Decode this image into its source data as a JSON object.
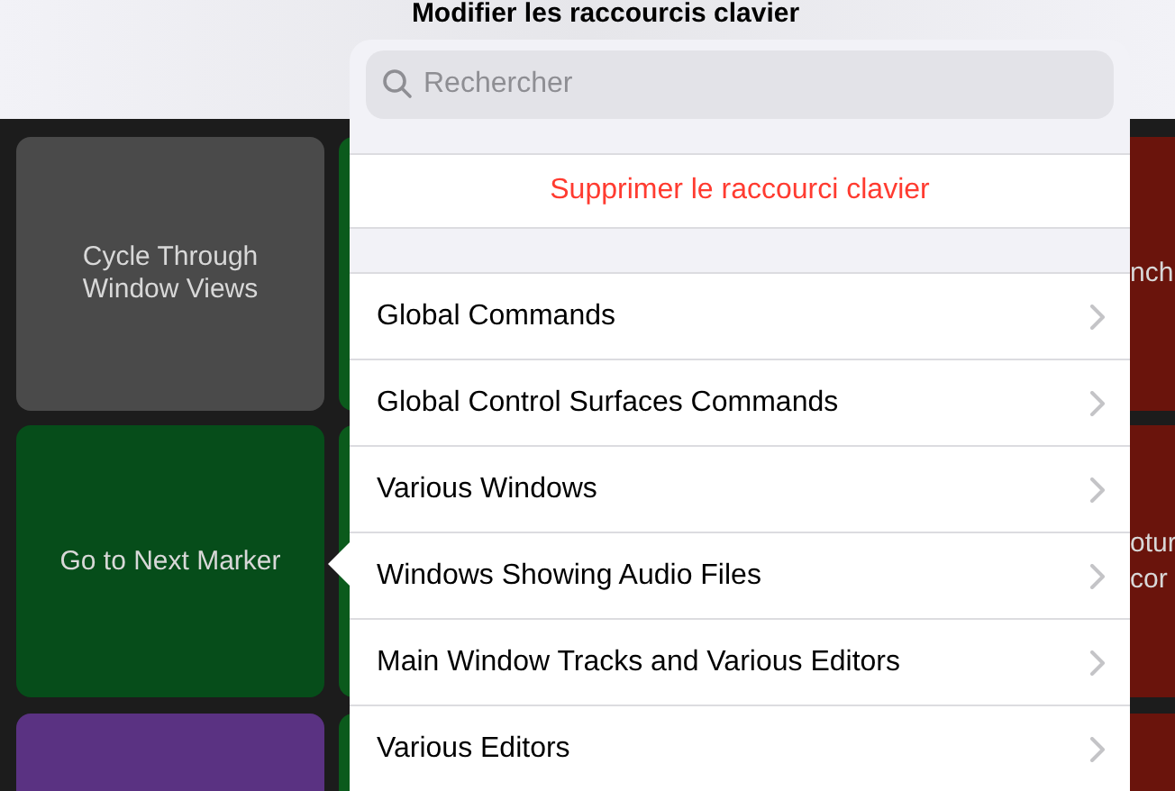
{
  "window": {
    "title": "Modifier les raccourcis clavier"
  },
  "grid": {
    "left_column": [
      {
        "label": "Cycle Through Window Views",
        "color": "#4a4a4a"
      },
      {
        "label": "Go to Next Marker",
        "color": "#064d1a"
      },
      {
        "color": "#5a3282"
      }
    ],
    "middle_column": [
      {
        "color": "#0b5a1c"
      },
      {
        "color": "#0b5a1c"
      },
      {
        "color": "#0b5a1c"
      }
    ],
    "right_column": [
      {
        "lines": [
          "nch"
        ],
        "color": "#6a140c"
      },
      {
        "lines": [
          "otur",
          "cor"
        ],
        "color": "#6a140c"
      },
      {
        "color": "#6a140c"
      }
    ]
  },
  "popover": {
    "search": {
      "placeholder": "Rechercher"
    },
    "delete_action": "Supprimer le raccourci clavier",
    "categories": [
      "Global Commands",
      "Global Control Surfaces Commands",
      "Various Windows",
      "Windows Showing Audio Files",
      "Main Window Tracks and Various Editors",
      "Various Editors"
    ]
  }
}
